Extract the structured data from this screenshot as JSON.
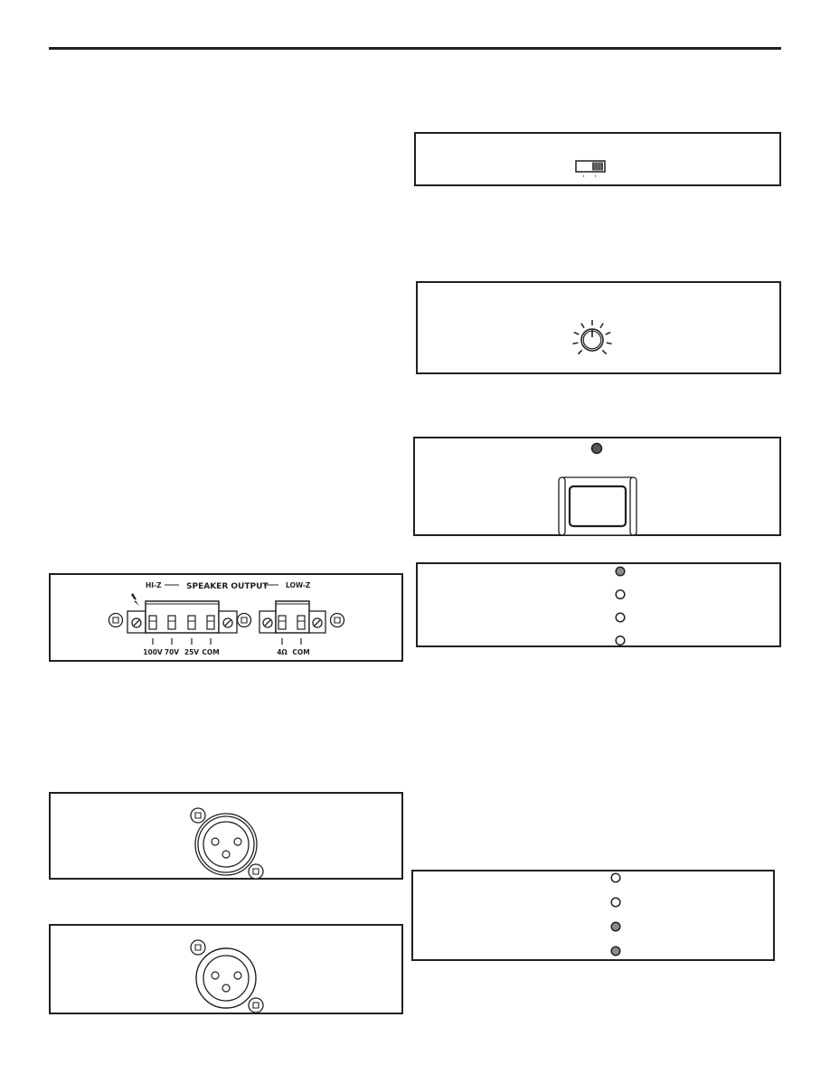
{
  "page": {
    "type": "equipment rear/front panel illustrations"
  },
  "mode_switch_panel": {
    "icon": "slide-switch-icon",
    "state": "right"
  },
  "level_knob_panel": {
    "icon": "rotary-knob-icon",
    "tick_count": 9,
    "pointer": "center-top"
  },
  "power_panel": {
    "led_icon": "power-led-icon",
    "led_state": "off",
    "switch_icon": "rocker-switch-icon"
  },
  "meter_panel_top": {
    "leds": [
      {
        "state": "lit",
        "color": "#8a8a8a"
      },
      {
        "state": "off",
        "color": "#ffffff"
      },
      {
        "state": "off",
        "color": "#ffffff"
      },
      {
        "state": "off",
        "color": "#ffffff"
      }
    ]
  },
  "meter_panel_bottom": {
    "leds": [
      {
        "state": "off",
        "color": "#ffffff"
      },
      {
        "state": "off",
        "color": "#ffffff"
      },
      {
        "state": "lit",
        "color": "#8a8a8a"
      },
      {
        "state": "lit",
        "color": "#8a8a8a"
      }
    ]
  },
  "speaker_output": {
    "title": "SPEAKER OUTPUT",
    "hi_z_label": "HI-Z",
    "low_z_label": "LOW-Z",
    "hi_z_terminals": [
      "100V",
      "70V",
      "25V",
      "COM"
    ],
    "low_z_terminals": [
      "4Ω",
      "COM"
    ],
    "warning_icon": "lightning-bolt-icon"
  },
  "xlr_panel_1": {
    "icon": "xlr-female-connector-icon",
    "pins": 3
  },
  "xlr_panel_2": {
    "icon": "xlr-female-connector-icon",
    "pins": 3
  }
}
